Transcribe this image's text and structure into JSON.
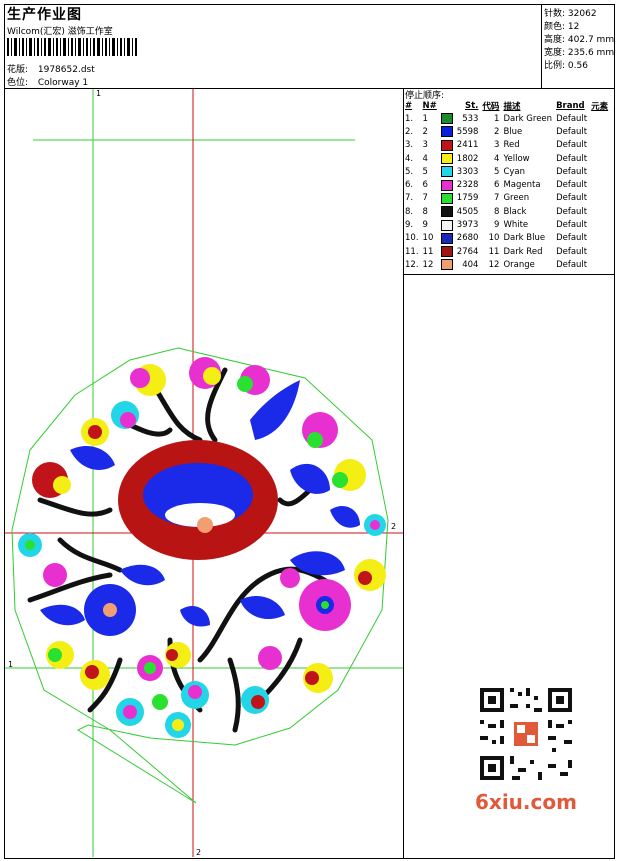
{
  "header": {
    "title": "生产作业图",
    "company": "Wilcom(汇宏) 滋饰工作室",
    "design_label": "花版:",
    "design_value": "1978652.dst",
    "colorway_label": "色位:",
    "colorway_value": "Colorway 1"
  },
  "stats": {
    "stitches_label": "针数:",
    "stitches_value": "32062",
    "colors_label": "颜色:",
    "colors_value": "12",
    "height_label": "高度:",
    "height_value": "402.7 mm",
    "width_label": "宽度:",
    "width_value": "235.6 mm",
    "ratio_label": "比例:",
    "ratio_value": "0.56"
  },
  "stop_sequence": {
    "title": "停止顺序:",
    "headers": [
      "#",
      "N#",
      "St.",
      "代码",
      "描述",
      "Brand",
      "元素"
    ],
    "rows": [
      {
        "n": "1.",
        "nn": "1",
        "st": "533",
        "code": "1",
        "desc": "Dark Green",
        "brand": "Default",
        "color": "#1a8c2a"
      },
      {
        "n": "2.",
        "nn": "2",
        "st": "5598",
        "code": "2",
        "desc": "Blue",
        "brand": "Default",
        "color": "#0a1ee0"
      },
      {
        "n": "3.",
        "nn": "3",
        "st": "2411",
        "code": "3",
        "desc": "Red",
        "brand": "Default",
        "color": "#c0141a"
      },
      {
        "n": "4.",
        "nn": "4",
        "st": "1802",
        "code": "4",
        "desc": "Yellow",
        "brand": "Default",
        "color": "#f5ee14"
      },
      {
        "n": "5.",
        "nn": "5",
        "st": "3303",
        "code": "5",
        "desc": "Cyan",
        "brand": "Default",
        "color": "#22d6e8"
      },
      {
        "n": "6.",
        "nn": "6",
        "st": "2328",
        "code": "6",
        "desc": "Magenta",
        "brand": "Default",
        "color": "#e830d0"
      },
      {
        "n": "7.",
        "nn": "7",
        "st": "1759",
        "code": "7",
        "desc": "Green",
        "brand": "Default",
        "color": "#2ae030"
      },
      {
        "n": "8.",
        "nn": "8",
        "st": "4505",
        "code": "8",
        "desc": "Black",
        "brand": "Default",
        "color": "#111111"
      },
      {
        "n": "9.",
        "nn": "9",
        "st": "3973",
        "code": "9",
        "desc": "White",
        "brand": "Default",
        "color": "#f4f4f4"
      },
      {
        "n": "10.",
        "nn": "10",
        "st": "2680",
        "code": "10",
        "desc": "Dark Blue",
        "brand": "Default",
        "color": "#1a2ab8"
      },
      {
        "n": "11.",
        "nn": "11",
        "st": "2764",
        "code": "11",
        "desc": "Dark Red",
        "brand": "Default",
        "color": "#a01414"
      },
      {
        "n": "12.",
        "nn": "12",
        "st": "404",
        "code": "12",
        "desc": "Orange",
        "brand": "Default",
        "color": "#f0a070"
      }
    ]
  },
  "markers": {
    "m1": "1",
    "m2": "2"
  },
  "watermark": "6xiu.com"
}
